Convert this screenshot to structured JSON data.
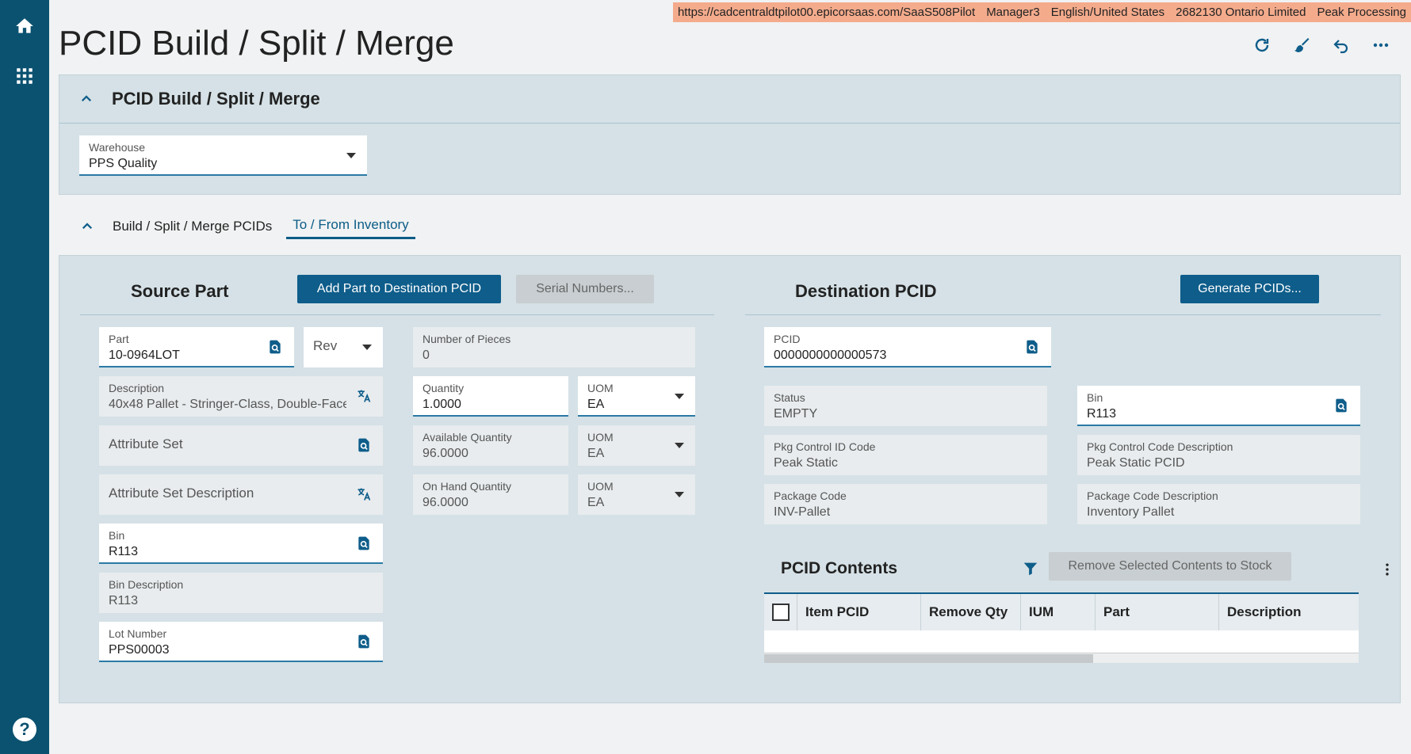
{
  "env": {
    "url": "https://cadcentraldtpilot00.epicorsaas.com/SaaS508Pilot",
    "user": "Manager3",
    "locale": "English/United States",
    "company": "2682130 Ontario Limited",
    "site": "Peak Processing"
  },
  "page": {
    "title": "PCID Build / Split / Merge"
  },
  "rail": {
    "items": [
      "home-icon",
      "apps-grid-icon"
    ],
    "help": "?"
  },
  "toolbar": {
    "icons": [
      "refresh-icon",
      "clear-icon",
      "undo-icon",
      "more-icon"
    ]
  },
  "header_panel": {
    "title": "PCID Build / Split / Merge",
    "warehouse": {
      "label": "Warehouse",
      "value": "PPS Quality"
    }
  },
  "tabs": [
    {
      "label": "Build / Split / Merge PCIDs",
      "active": false
    },
    {
      "label": "To / From Inventory",
      "active": true
    }
  ],
  "source": {
    "title": "Source Part",
    "add_button": "Add Part to Destination PCID",
    "serial_button": "Serial Numbers...",
    "part": {
      "label": "Part",
      "value": "10-0964LOT"
    },
    "rev": {
      "placeholder": "Rev"
    },
    "description": {
      "label": "Description",
      "value": "40x48 Pallet - Stringer-Class, Double-Face"
    },
    "attribute_set": {
      "placeholder": "Attribute Set"
    },
    "attribute_set_desc": {
      "placeholder": "Attribute Set Description"
    },
    "bin": {
      "label": "Bin",
      "value": "R113"
    },
    "bin_desc": {
      "label": "Bin Description",
      "value": "R113"
    },
    "lot": {
      "label": "Lot Number",
      "value": "PPS00003"
    },
    "pieces": {
      "label": "Number of Pieces",
      "value": "0"
    },
    "quantity": {
      "label": "Quantity",
      "value": "1.0000"
    },
    "quantity_uom": {
      "label": "UOM",
      "value": "EA"
    },
    "available": {
      "label": "Available Quantity",
      "value": "96.0000"
    },
    "available_uom": {
      "label": "UOM",
      "value": "EA"
    },
    "onhand": {
      "label": "On Hand Quantity",
      "value": "96.0000"
    },
    "onhand_uom": {
      "label": "UOM",
      "value": "EA"
    }
  },
  "destination": {
    "title": "Destination PCID",
    "generate_button": "Generate PCIDs...",
    "pcid": {
      "label": "PCID",
      "value": "0000000000000573"
    },
    "status": {
      "label": "Status",
      "value": "EMPTY"
    },
    "bin": {
      "label": "Bin",
      "value": "R113"
    },
    "pkg_ctrl": {
      "label": "Pkg Control ID Code",
      "value": "Peak Static"
    },
    "pkg_ctrl_desc": {
      "label": "Pkg Control Code Description",
      "value": "Peak Static PCID"
    },
    "package": {
      "label": "Package Code",
      "value": "INV-Pallet"
    },
    "package_desc": {
      "label": "Package Code Description",
      "value": "Inventory Pallet"
    }
  },
  "contents": {
    "title": "PCID Contents",
    "remove_button": "Remove Selected Contents to Stock",
    "columns": [
      "Item PCID",
      "Remove Qty",
      "IUM",
      "Part",
      "Description"
    ],
    "rows": []
  },
  "colors": {
    "rail": "#0b5270",
    "accent": "#0e5d8a",
    "env_bar": "#f4ab8c",
    "panel": "#d5e1e6"
  }
}
